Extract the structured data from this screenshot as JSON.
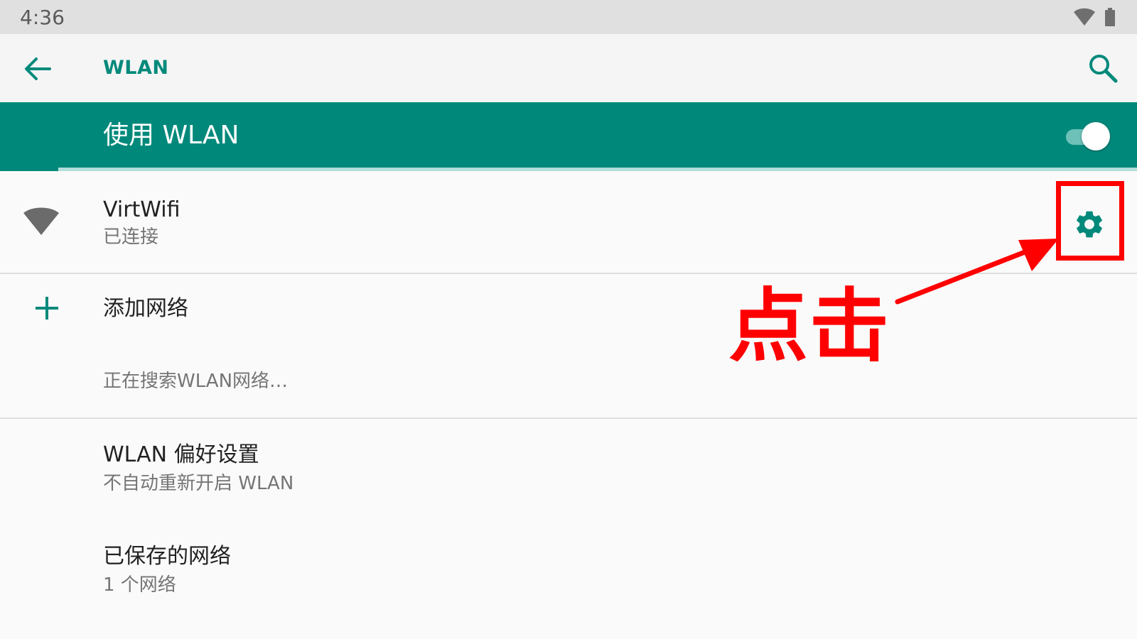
{
  "status_bar": {
    "time": "4:36",
    "wifi_icon": "wifi-signal-full",
    "battery_icon": "battery-full"
  },
  "toolbar": {
    "back_icon": "arrow-left",
    "title": "WLAN",
    "search_icon": "magnifier"
  },
  "master_switch": {
    "label": "使用 WLAN",
    "enabled": true
  },
  "networks": [
    {
      "name": "VirtWifi",
      "status": "已连接",
      "signal_icon": "wifi-signal-full",
      "settings_icon": "gear"
    }
  ],
  "add_network": {
    "icon": "plus",
    "label": "添加网络"
  },
  "scanning_text": "正在搜索WLAN网络…",
  "preferences": {
    "title": "WLAN 偏好设置",
    "summary": "不自动重新开启 WLAN"
  },
  "saved_networks": {
    "title": "已保存的网络",
    "summary": "1 个网络"
  },
  "annotation": {
    "label": "点击",
    "color": "#ff0000"
  },
  "colors": {
    "accent": "#00897b",
    "status_bar": "#e0e0e0",
    "toolbar": "#f5f5f5",
    "background": "#fafafa",
    "annotation": "#ff0000"
  }
}
